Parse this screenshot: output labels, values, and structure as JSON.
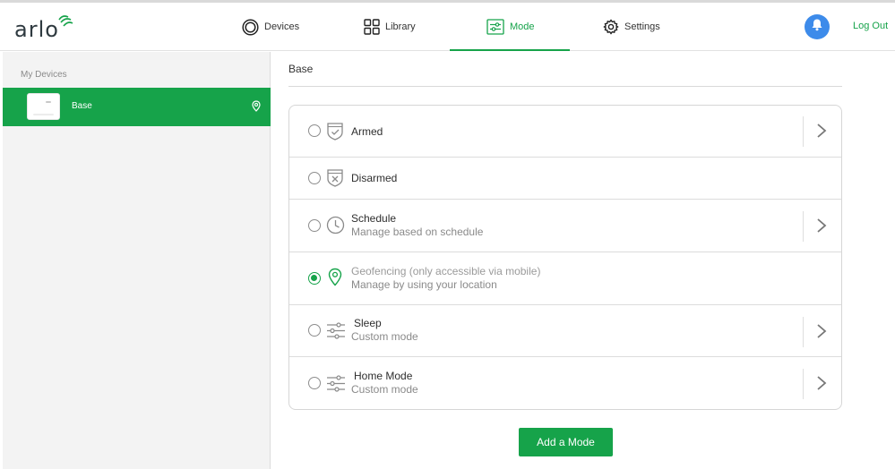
{
  "brand": {
    "logo_text": "arlo",
    "accent": "#16a34a"
  },
  "nav": {
    "items": [
      {
        "label": "Devices",
        "icon": "devices-icon"
      },
      {
        "label": "Library",
        "icon": "library-grid-icon"
      },
      {
        "label": "Mode",
        "icon": "mode-sliders-icon",
        "active": true
      },
      {
        "label": "Settings",
        "icon": "gear-icon"
      }
    ],
    "notifications_icon": "bell-icon",
    "logout_label": "Log Out"
  },
  "sidebar": {
    "heading": "My Devices",
    "devices": [
      {
        "name": "Base",
        "selected": true,
        "icon": "location-pin-icon"
      }
    ]
  },
  "main": {
    "title": "Base",
    "modes": [
      {
        "name": "Armed",
        "description": "",
        "icon": "shield-check-icon",
        "selected": false,
        "has_chevron": true
      },
      {
        "name": "Disarmed",
        "description": "",
        "icon": "shield-x-icon",
        "selected": false,
        "has_chevron": false
      },
      {
        "name": "Schedule",
        "description": "Manage based on schedule",
        "icon": "clock-icon",
        "selected": false,
        "has_chevron": true
      },
      {
        "name": "Geofencing (only accessible via mobile)",
        "description": "Manage by using your location",
        "icon": "location-pin-icon",
        "selected": true,
        "has_chevron": false
      },
      {
        "name": "Sleep",
        "description": "Custom mode",
        "icon": "sliders-icon",
        "selected": false,
        "has_chevron": true
      },
      {
        "name": "Home Mode",
        "description": "Custom mode",
        "icon": "sliders-icon",
        "selected": false,
        "has_chevron": true
      }
    ],
    "add_button_label": "Add a Mode"
  }
}
